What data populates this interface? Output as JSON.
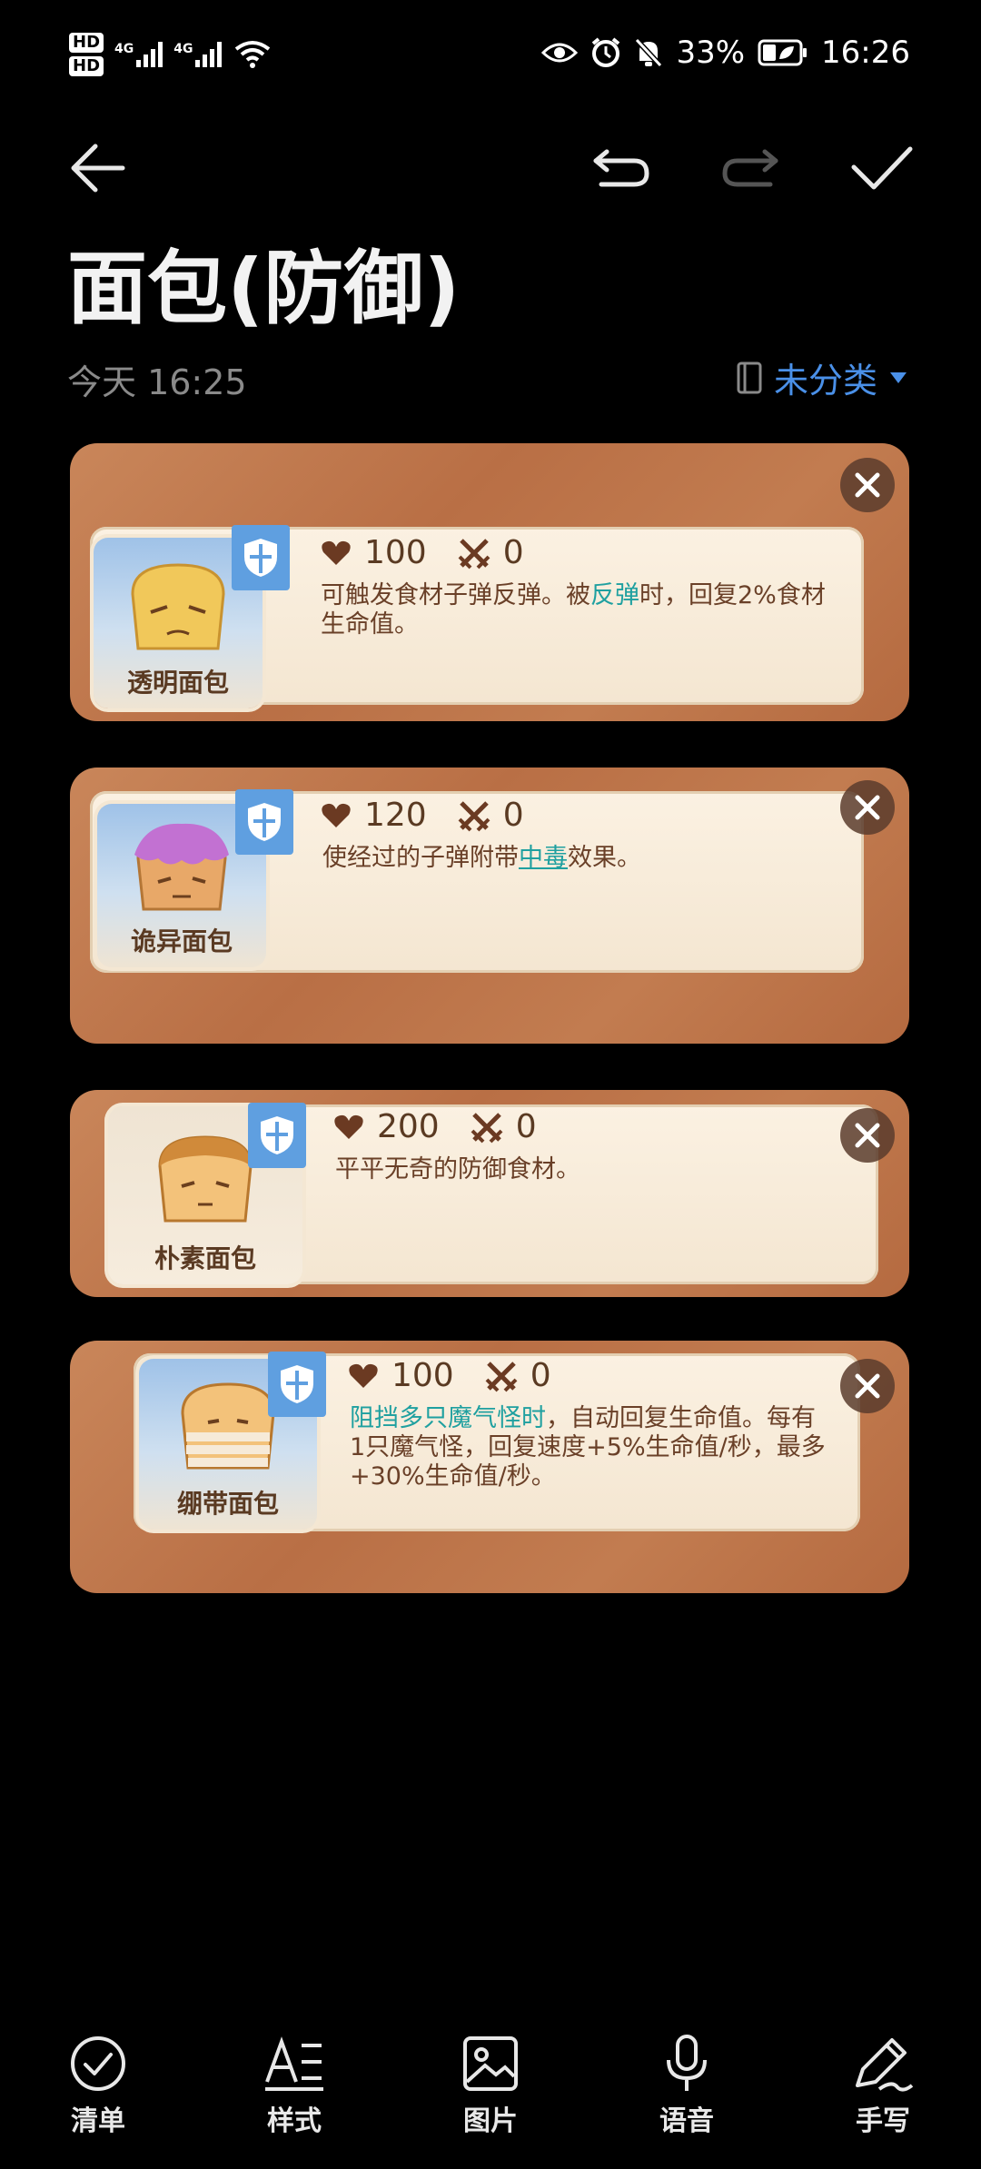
{
  "status_bar": {
    "hd1": "HD",
    "hd2": "HD",
    "net1": "4G",
    "net2": "4G",
    "battery": "33%",
    "time": "16:26"
  },
  "note": {
    "title": "面包(防御)",
    "date": "今天 16:25",
    "category": "未分类"
  },
  "cards": [
    {
      "name": "透明面包",
      "hp": "100",
      "atk": "0",
      "desc_parts": [
        "可触发食材子弹反弹。被",
        "反弹",
        "时，回复2%食材生命值。"
      ]
    },
    {
      "name": "诡异面包",
      "hp": "120",
      "atk": "0",
      "desc_parts": [
        "使经过的子弹附带",
        "中毒",
        "效果。"
      ]
    },
    {
      "name": "朴素面包",
      "hp": "200",
      "atk": "0",
      "desc": "平平无奇的防御食材。"
    },
    {
      "name": "绷带面包",
      "hp": "100",
      "atk": "0",
      "desc_parts": [
        "阻挡多只魔气怪时",
        "，自动回复生命值。每有1只魔气怪，回复速度+5%生命值/秒，最多+30%生命值/秒。"
      ]
    }
  ],
  "bottom_bar": {
    "items": [
      {
        "label": "清单",
        "icon": "checklist-icon"
      },
      {
        "label": "样式",
        "icon": "text-style-icon"
      },
      {
        "label": "图片",
        "icon": "image-icon"
      },
      {
        "label": "语音",
        "icon": "microphone-icon"
      },
      {
        "label": "手写",
        "icon": "handwriting-icon"
      }
    ]
  },
  "colors": {
    "accent": "#4a90e8",
    "card_bg": "#c27c50",
    "panel_bg": "#fbf1e2",
    "highlight": "#1fa0a0"
  }
}
